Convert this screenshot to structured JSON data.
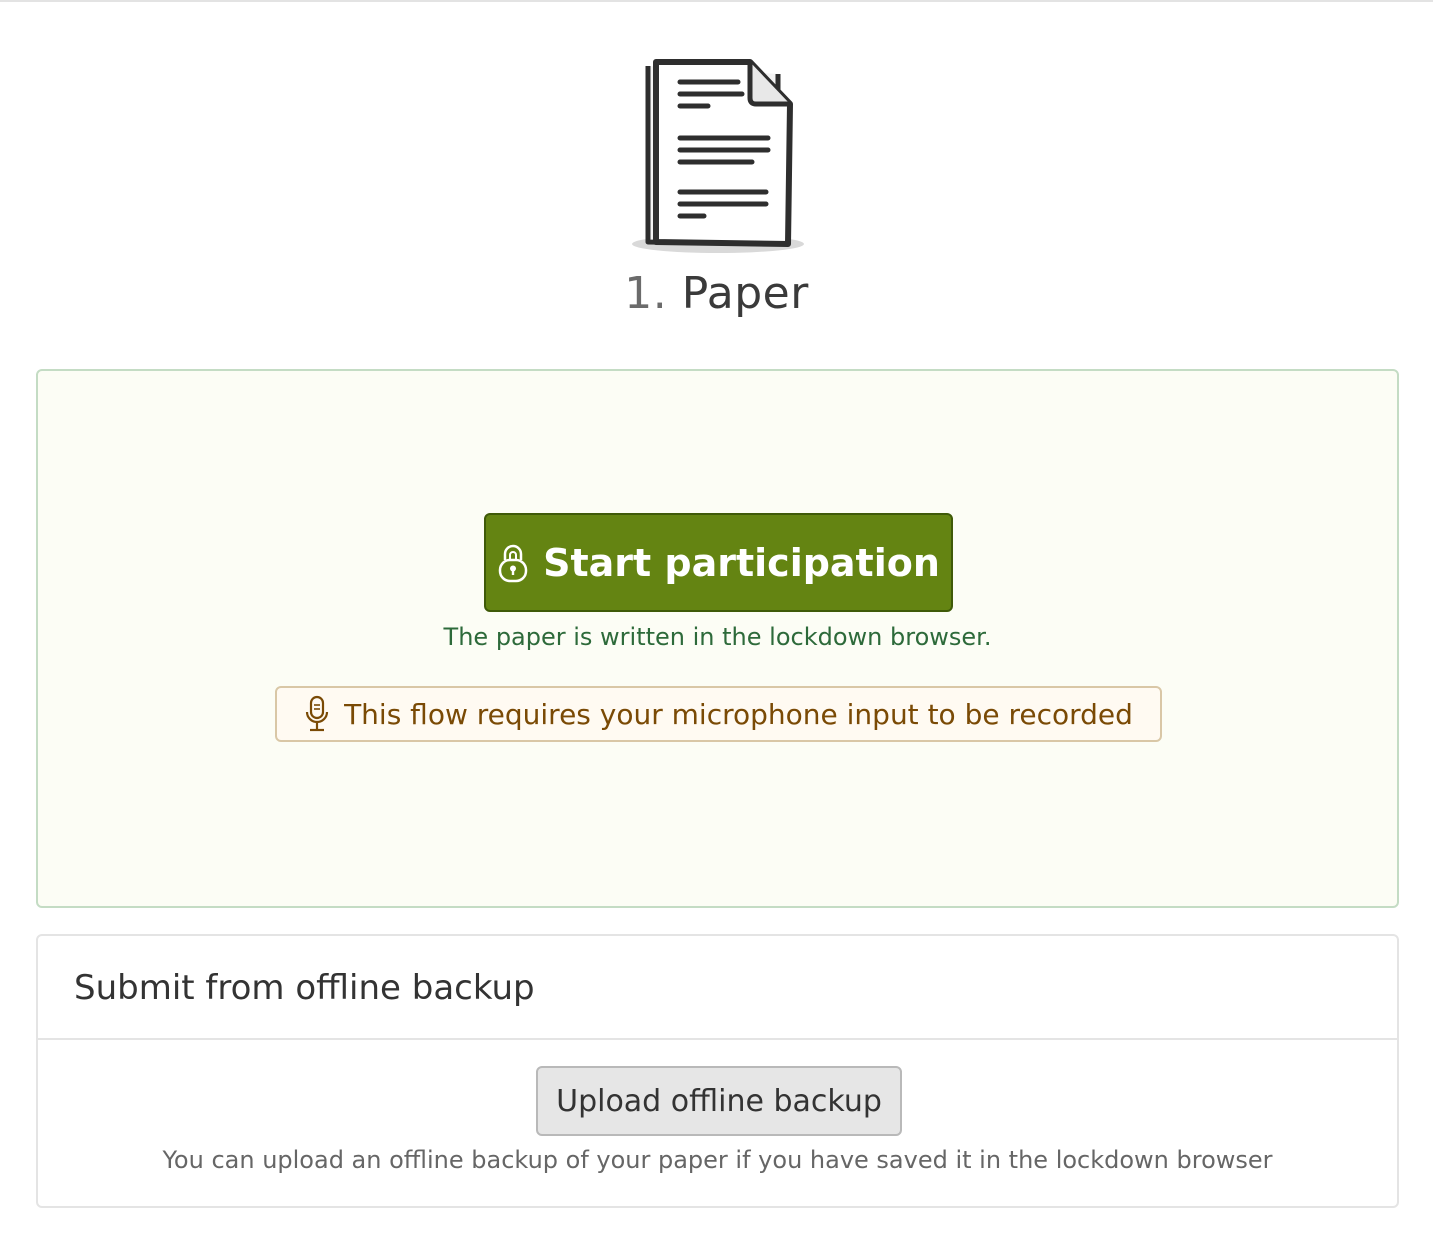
{
  "header": {
    "icon": "paper-document-icon",
    "title_number": "1.",
    "title_text": "Paper"
  },
  "participation": {
    "start_button_label": "Start participation",
    "start_button_icon": "lock-icon",
    "lockdown_note": "The paper is written in the lockdown browser.",
    "microphone_icon": "microphone-icon",
    "microphone_notice": "This flow requires your microphone input to be recorded"
  },
  "offline_backup": {
    "title": "Submit from offline backup",
    "upload_button_label": "Upload offline backup",
    "help_text": "You can upload an offline backup of your paper if you have saved it in the lockdown browser"
  },
  "colors": {
    "start_button": "#648412",
    "box_background": "#fcfdf5",
    "note_text": "#2d6a3a",
    "mic_text": "#7a4a05"
  }
}
